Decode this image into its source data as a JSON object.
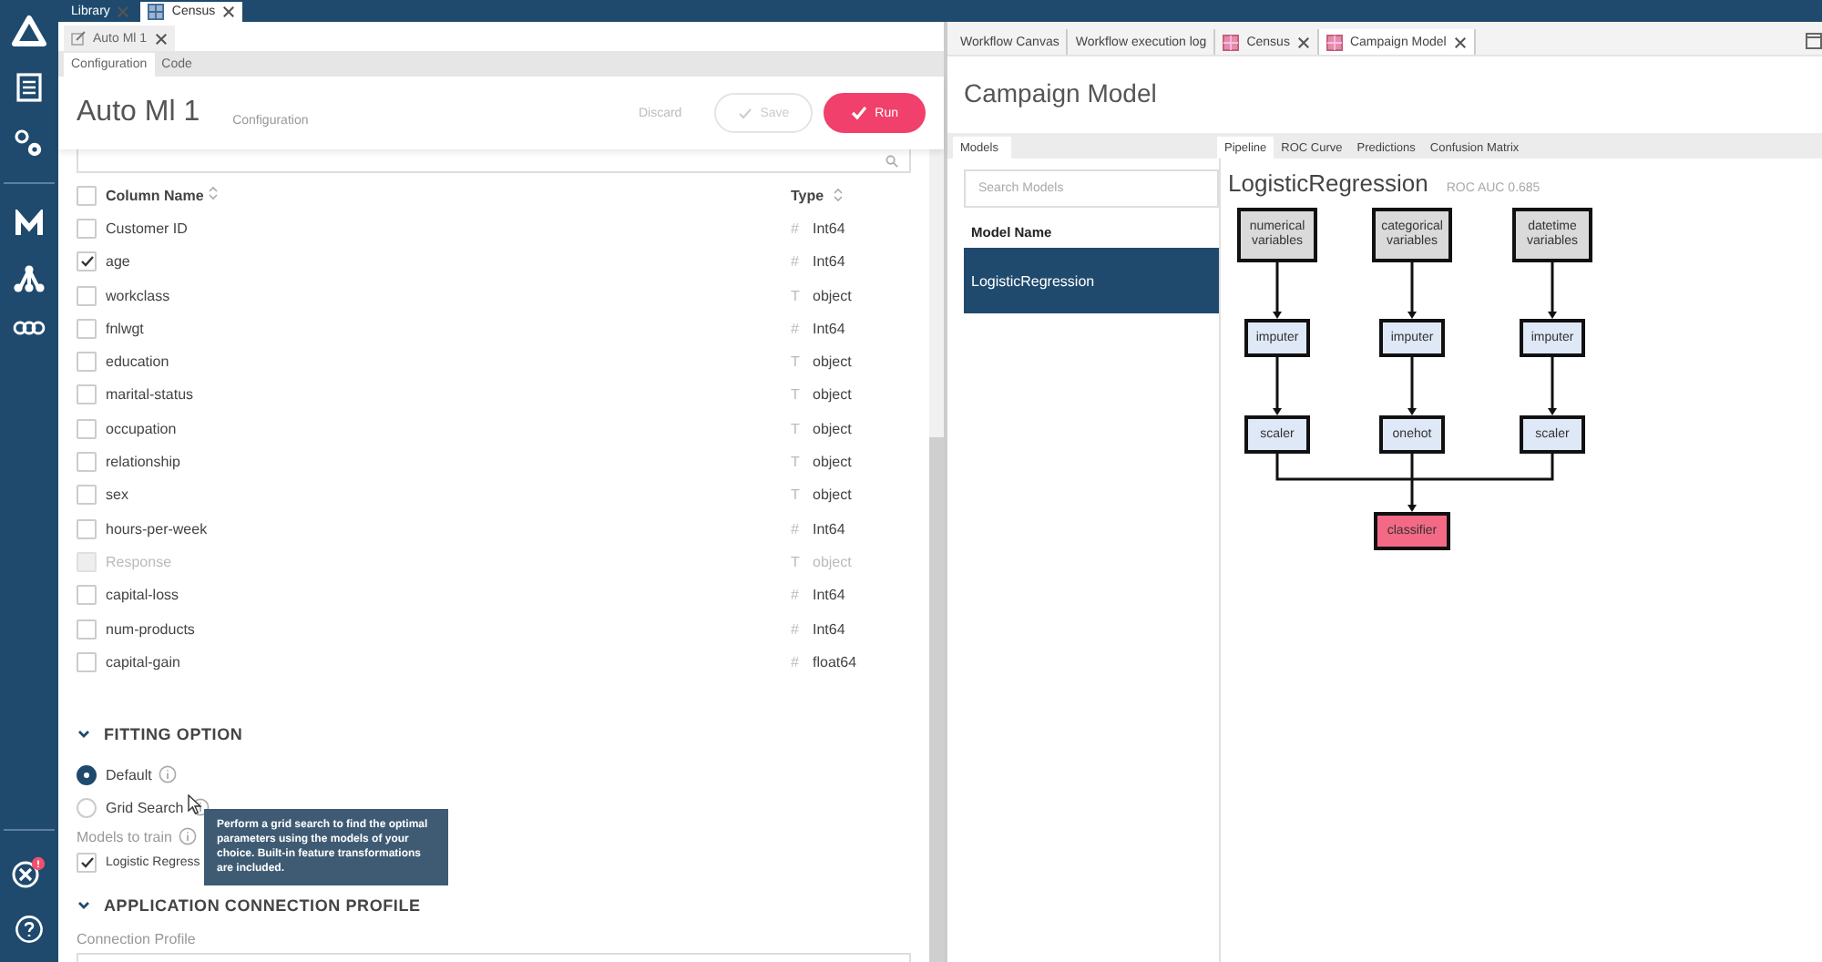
{
  "app_tabs": [
    {
      "label": "Library",
      "selected": false
    },
    {
      "label": "Census",
      "selected": true
    }
  ],
  "left_pane": {
    "document_tab": "Auto Ml 1",
    "view_tabs": [
      {
        "label": "Configuration",
        "selected": true
      },
      {
        "label": "Code",
        "selected": false
      }
    ],
    "title": "Auto Ml 1",
    "subtitle": "Configuration",
    "actions": [
      {
        "kind": "link",
        "label": "Discard",
        "disabled": false
      },
      {
        "kind": "save",
        "label": "Save",
        "disabled": true
      },
      {
        "kind": "run",
        "label": "Run",
        "disabled": false
      }
    ],
    "columns_table": {
      "columns": [
        "Column Name",
        "Type"
      ],
      "all_checked": false,
      "rows": [
        {
          "name": "Customer ID",
          "type": "Int64",
          "type_symbol": "#",
          "checked": false,
          "disabled": false
        },
        {
          "name": "age",
          "type": "Int64",
          "type_symbol": "#",
          "checked": true,
          "disabled": false
        },
        {
          "name": "workclass",
          "type": "object",
          "type_symbol": "T",
          "checked": false,
          "disabled": false
        },
        {
          "name": "fnlwgt",
          "type": "Int64",
          "type_symbol": "#",
          "checked": false,
          "disabled": false
        },
        {
          "name": "education",
          "type": "object",
          "type_symbol": "T",
          "checked": false,
          "disabled": false
        },
        {
          "name": "marital-status",
          "type": "object",
          "type_symbol": "T",
          "checked": false,
          "disabled": false
        },
        {
          "name": "occupation",
          "type": "object",
          "type_symbol": "T",
          "checked": false,
          "disabled": false
        },
        {
          "name": "relationship",
          "type": "object",
          "type_symbol": "T",
          "checked": false,
          "disabled": false
        },
        {
          "name": "sex",
          "type": "object",
          "type_symbol": "T",
          "checked": false,
          "disabled": false
        },
        {
          "name": "hours-per-week",
          "type": "Int64",
          "type_symbol": "#",
          "checked": false,
          "disabled": false
        },
        {
          "name": "Response",
          "type": "object",
          "type_symbol": "T",
          "checked": false,
          "disabled": true
        },
        {
          "name": "capital-loss",
          "type": "Int64",
          "type_symbol": "#",
          "checked": false,
          "disabled": false
        },
        {
          "name": "num-products",
          "type": "Int64",
          "type_symbol": "#",
          "checked": false,
          "disabled": false
        },
        {
          "name": "capital-gain",
          "type": "float64",
          "type_symbol": "#",
          "checked": false,
          "disabled": false
        }
      ]
    },
    "fitting_option": {
      "title": "FITTING OPTION",
      "expanded": true,
      "options": [
        {
          "label": "Default",
          "selected": true
        },
        {
          "label": "Grid Search",
          "selected": false
        }
      ],
      "models_label": "Models to train",
      "models": [
        {
          "label": "Logistic Regress",
          "checked": true
        }
      ],
      "tooltip": "Perform a grid search to find the optimal parameters using the models of your choice. Built-in feature transformations are included."
    },
    "connection": {
      "title": "APPLICATION CONNECTION PROFILE",
      "expanded": true,
      "field_label": "Connection Profile"
    }
  },
  "right_pane": {
    "tabs": [
      {
        "label": "Workflow Canvas",
        "closable": false,
        "selected": false
      },
      {
        "label": "Workflow execution log",
        "closable": false,
        "selected": false
      },
      {
        "label": "Census",
        "closable": true,
        "selected": false
      },
      {
        "label": "Campaign Model",
        "closable": true,
        "selected": true
      }
    ],
    "title": "Campaign Model",
    "models_tab": "Models",
    "panel_tabs": [
      {
        "label": "Pipeline",
        "selected": true
      },
      {
        "label": "ROC Curve",
        "selected": false
      },
      {
        "label": "Predictions",
        "selected": false
      },
      {
        "label": "Confusion Matrix",
        "selected": false
      }
    ],
    "search": {
      "placeholder": "Search Models"
    },
    "models_header": "Model Name",
    "models": [
      {
        "label": "LogisticRegression",
        "selected": true
      }
    ],
    "model_title": "LogisticRegression",
    "metric": "ROC AUC 0.685",
    "pipeline": {
      "branches": [
        {
          "input": "numerical variables",
          "steps": [
            "imputer",
            "scaler"
          ]
        },
        {
          "input": "categorical variables",
          "steps": [
            "imputer",
            "onehot"
          ]
        },
        {
          "input": "datetime variables",
          "steps": [
            "imputer",
            "scaler"
          ]
        }
      ],
      "output": "classifier"
    }
  }
}
